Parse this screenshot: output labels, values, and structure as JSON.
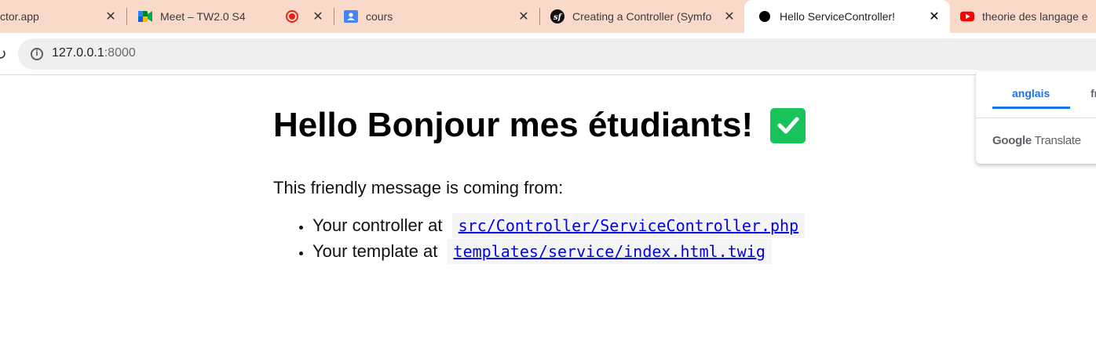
{
  "browser": {
    "tabs": [
      {
        "title": "ctor.app",
        "favicon": "tab-favicon-none",
        "active": false
      },
      {
        "title": "Meet – TW2.0 S4",
        "favicon": "meet-icon",
        "active": false,
        "recording": true
      },
      {
        "title": "cours",
        "favicon": "classroom-icon",
        "active": false
      },
      {
        "title": "Creating a Controller (Symfo",
        "favicon": "symfony-icon",
        "active": false
      },
      {
        "title": "Hello ServiceController!",
        "favicon": "page-dot-icon",
        "active": true
      },
      {
        "title": "theorie des langage e",
        "favicon": "youtube-icon",
        "active": false
      }
    ],
    "address": {
      "host": "127.0.0.1",
      "port": ":8000"
    },
    "colors": {
      "tabstrip": "#f9d9c9",
      "omnibox": "#efefef",
      "link": "#0000ee",
      "check": "#18c45a"
    }
  },
  "page": {
    "heading": "Hello Bonjour mes étudiants!",
    "heading_icon": "check-mark-button-icon",
    "intro": "This friendly message is coming from:",
    "items": [
      {
        "label": "Your controller at",
        "path": "src/Controller/ServiceController.php"
      },
      {
        "label": "Your template at",
        "path": "templates/service/index.html.twig"
      }
    ]
  },
  "translate_popup": {
    "languages": [
      "anglais",
      "fr"
    ],
    "selected": "anglais",
    "brand_google": "Google",
    "brand_product": "Translate"
  }
}
